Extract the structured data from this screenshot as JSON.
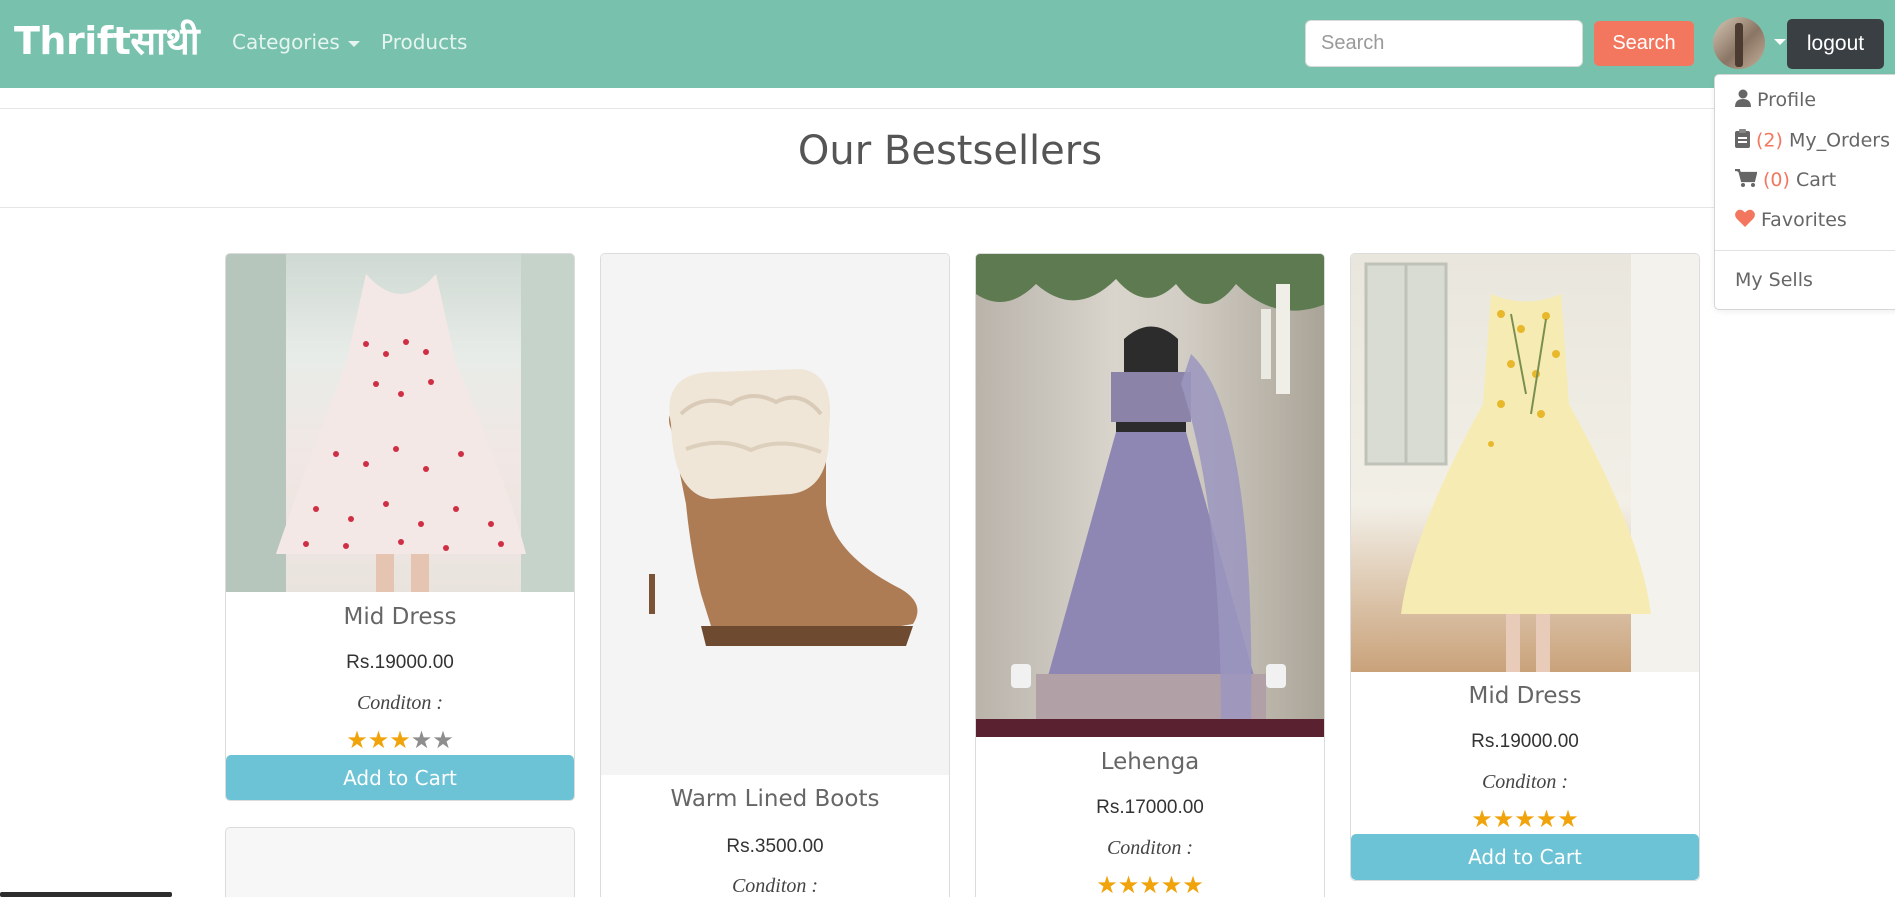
{
  "navbar": {
    "brand": "Thriftसाथी",
    "categories_label": "Categories",
    "products_label": "Products",
    "search_placeholder": "Search",
    "search_value": "",
    "search_button": "Search",
    "logout_button": "logout",
    "color": "#78c2ad"
  },
  "user_menu": {
    "items": [
      {
        "icon": "user-icon",
        "label": "Profile"
      },
      {
        "icon": "clipboard-icon",
        "count": "(2)",
        "label": "My_Orders"
      },
      {
        "icon": "cart-icon",
        "count": "(0)",
        "label": "Cart"
      },
      {
        "icon": "heart-icon",
        "label": "Favorites"
      }
    ],
    "my_sells": "My Sells"
  },
  "section": {
    "title": "Our Bestsellers"
  },
  "products": [
    {
      "name": "Mid Dress",
      "price": "Rs.19000.00",
      "condition_label": "Conditon :",
      "rating": 3,
      "max_rating": 5,
      "button": "Add to Cart"
    },
    {
      "name": "Warm Lined Boots",
      "price": "Rs.3500.00",
      "condition_label": "Conditon :"
    },
    {
      "name": "Lehenga",
      "price": "Rs.17000.00",
      "condition_label": "Conditon :",
      "rating": 5,
      "max_rating": 5
    },
    {
      "name": "Mid Dress",
      "price": "Rs.19000.00",
      "condition_label": "Conditon :",
      "rating": 5,
      "max_rating": 5,
      "button": "Add to Cart"
    }
  ],
  "colors": {
    "accent": "#78c2ad",
    "search_button": "#f3775f",
    "logout": "#3a3f44",
    "add_to_cart": "#6cc3d5",
    "star": "#f0a30a"
  }
}
